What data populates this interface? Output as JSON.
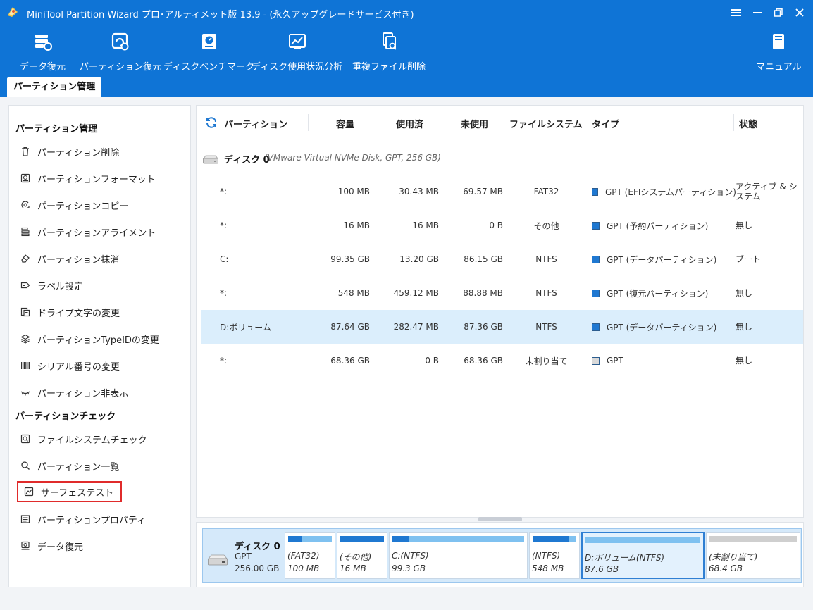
{
  "window": {
    "title": "MiniTool Partition Wizard プロ･アルティメット版 13.9 - (永久アップグレードサービス付き)"
  },
  "toolbar": {
    "items": [
      {
        "label": "データ復元",
        "icon": "data-recovery-icon"
      },
      {
        "label": "パーティション復元",
        "icon": "partition-recovery-icon"
      },
      {
        "label": "ディスクベンチマーク",
        "icon": "disk-benchmark-icon"
      },
      {
        "label": "ディスク使用状況分析",
        "icon": "space-analyzer-icon"
      },
      {
        "label": "重複ファイル削除",
        "icon": "duplicate-file-icon"
      }
    ],
    "manual": {
      "label": "マニュアル",
      "icon": "manual-book-icon"
    }
  },
  "tabs": {
    "active": "パーティション管理"
  },
  "sidebar": {
    "section1": "パーティション管理",
    "items1": [
      {
        "label": "パーティション削除",
        "icon": "trash-icon"
      },
      {
        "label": "パーティションフォーマット",
        "icon": "format-icon"
      },
      {
        "label": "パーティションコピー",
        "icon": "copy-icon"
      },
      {
        "label": "パーティションアライメント",
        "icon": "align-icon"
      },
      {
        "label": "パーティション抹消",
        "icon": "eraser-icon"
      },
      {
        "label": "ラベル設定",
        "icon": "label-icon"
      },
      {
        "label": "ドライブ文字の変更",
        "icon": "drive-letter-icon"
      },
      {
        "label": "パーティションTypeIDの変更",
        "icon": "layers-icon"
      },
      {
        "label": "シリアル番号の変更",
        "icon": "barcode-icon"
      },
      {
        "label": "パーティション非表示",
        "icon": "hide-eye-icon"
      }
    ],
    "section2": "パーティションチェック",
    "items2": [
      {
        "label": "ファイルシステムチェック",
        "icon": "file-check-icon"
      },
      {
        "label": "パーティション一覧",
        "icon": "magnifier-icon"
      },
      {
        "label": "サーフェステスト",
        "icon": "surface-test-icon"
      },
      {
        "label": "パーティションプロパティ",
        "icon": "properties-icon"
      },
      {
        "label": "データ復元",
        "icon": "data-recovery-small-icon"
      }
    ]
  },
  "table": {
    "headers": {
      "partition": "パーティション",
      "capacity": "容量",
      "used": "使用済",
      "unused": "未使用",
      "filesystem": "ファイルシステム",
      "type": "タイプ",
      "status": "状態"
    },
    "disk": {
      "label": "ディスク 0",
      "info": "(VMware Virtual NVMe Disk, GPT, 256 GB)"
    },
    "rows": [
      {
        "partition": "*:",
        "capacity": "100 MB",
        "used": "30.43 MB",
        "unused": "69.57 MB",
        "fs": "FAT32",
        "type": "GPT (EFIシステムパーティション)",
        "status": "アクティブ & システム",
        "type_color": "#1f78d1"
      },
      {
        "partition": "*:",
        "capacity": "16 MB",
        "used": "16 MB",
        "unused": "0 B",
        "fs": "その他",
        "type": "GPT (予約パーティション)",
        "status": "無し",
        "type_color": "#1f78d1"
      },
      {
        "partition": "C:",
        "capacity": "99.35 GB",
        "used": "13.20 GB",
        "unused": "86.15 GB",
        "fs": "NTFS",
        "type": "GPT (データパーティション)",
        "status": "ブート",
        "type_color": "#1f78d1"
      },
      {
        "partition": "*:",
        "capacity": "548 MB",
        "used": "459.12 MB",
        "unused": "88.88 MB",
        "fs": "NTFS",
        "type": "GPT (復元パーティション)",
        "status": "無し",
        "type_color": "#1f78d1"
      },
      {
        "partition": "D:ボリューム",
        "capacity": "87.64 GB",
        "used": "282.47 MB",
        "unused": "87.36 GB",
        "fs": "NTFS",
        "type": "GPT (データパーティション)",
        "status": "無し",
        "type_color": "#1f78d1"
      },
      {
        "partition": "*:",
        "capacity": "68.36 GB",
        "used": "0 B",
        "unused": "68.36 GB",
        "fs": "未割り当て",
        "type": "GPT",
        "status": "無し",
        "type_color": "#d9d9d9"
      }
    ]
  },
  "diskmap": {
    "disk": {
      "title": "ディスク 0",
      "type": "GPT",
      "size": "256.00 GB"
    },
    "partitions": [
      {
        "name": "(FAT32)",
        "size": "100 MB",
        "used_fraction": 0.3
      },
      {
        "name": "(その他)",
        "size": "16 MB",
        "used_fraction": 1.0
      },
      {
        "name": "C:(NTFS)",
        "size": "99.3 GB",
        "used_fraction": 0.13
      },
      {
        "name": "(NTFS)",
        "size": "548 MB",
        "used_fraction": 0.84
      },
      {
        "name": "D:ボリューム(NTFS)",
        "size": "87.6 GB",
        "used_fraction": 0.0
      },
      {
        "name": "(未割り当て)",
        "size": "68.4 GB",
        "used_fraction": 0.0
      }
    ]
  },
  "colors": {
    "header_blue": "#0f74d6",
    "used_bar": "#1f78d1",
    "free_bar": "#7fc1f0",
    "unallocated_bar": "#cfcfcf",
    "selected_row": "#dbeefc",
    "highlight_border": "#e02b2b"
  }
}
